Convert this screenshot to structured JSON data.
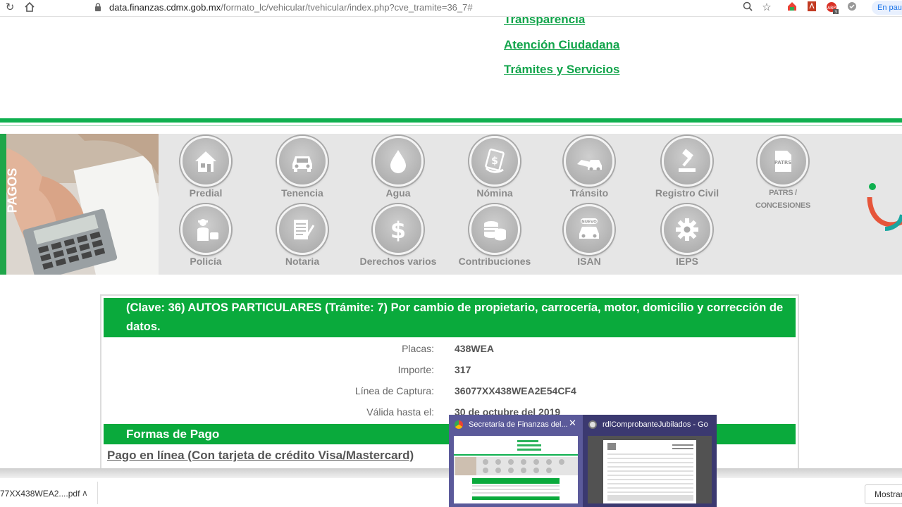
{
  "browser": {
    "url_host": "data.finanzas.cdmx.gob.mx",
    "url_path": "/formato_lc/vehicular/tvehicular/index.php?cve_tramite=36_7#",
    "profile_label": "En paus",
    "extension_badge": "3"
  },
  "top_links": [
    "Transparencia",
    "Atención Ciudadana",
    "Trámites y Servicios"
  ],
  "banner": {
    "side_text": "PAGOS",
    "services": [
      {
        "label": "Predial",
        "icon": "house-icon"
      },
      {
        "label": "Tenencia",
        "icon": "car-icon"
      },
      {
        "label": "Agua",
        "icon": "water-drop-icon"
      },
      {
        "label": "Nómina",
        "icon": "payroll-icon"
      },
      {
        "label": "Tránsito",
        "icon": "traffic-icon"
      },
      {
        "label": "Registro Civil",
        "icon": "gavel-icon"
      },
      {
        "label": "PATRS / CONCESIONES",
        "icon": "patrs-doc-icon",
        "badge": "PATRS"
      },
      {
        "label": "Policía",
        "icon": "police-icon"
      },
      {
        "label": "Notaria",
        "icon": "notary-icon"
      },
      {
        "label": "Derechos varios",
        "icon": "dollar-icon"
      },
      {
        "label": "Contribuciones",
        "icon": "coins-icon"
      },
      {
        "label": "ISAN",
        "icon": "new-car-icon",
        "badge": "NUEVO"
      },
      {
        "label": "IEPS",
        "icon": "gear-icon"
      }
    ]
  },
  "tramite": {
    "header": "(Clave: 36) AUTOS PARTICULARES (Trámite: 7) Por cambio de propietario, carrocería, motor, domicilio y corrección de datos.",
    "rows": [
      {
        "label": "Placas:",
        "value": "438WEA"
      },
      {
        "label": "Importe:",
        "value": "317"
      },
      {
        "label": "Línea de Captura:",
        "value": "36077XX438WEA2E54CF4"
      },
      {
        "label": "Válida hasta el:",
        "value": "30 de octubre del 2019"
      }
    ],
    "formas_header": "Formas de Pago",
    "pago_link": "Pago en línea (Con tarjeta de crédito Visa/Mastercard)"
  },
  "downloads": {
    "file_name": "77XX438WEA2....pdf",
    "show_all": "Mostrar"
  },
  "taskbar_thumbs": [
    {
      "title": "Secretaría de Finanzas del..."
    },
    {
      "title": "rdlComprobanteJubilados - Go..."
    }
  ],
  "colors": {
    "green": "#0aaa3c",
    "link_green": "#12a44b",
    "banner_gray": "#e6e6e6"
  }
}
